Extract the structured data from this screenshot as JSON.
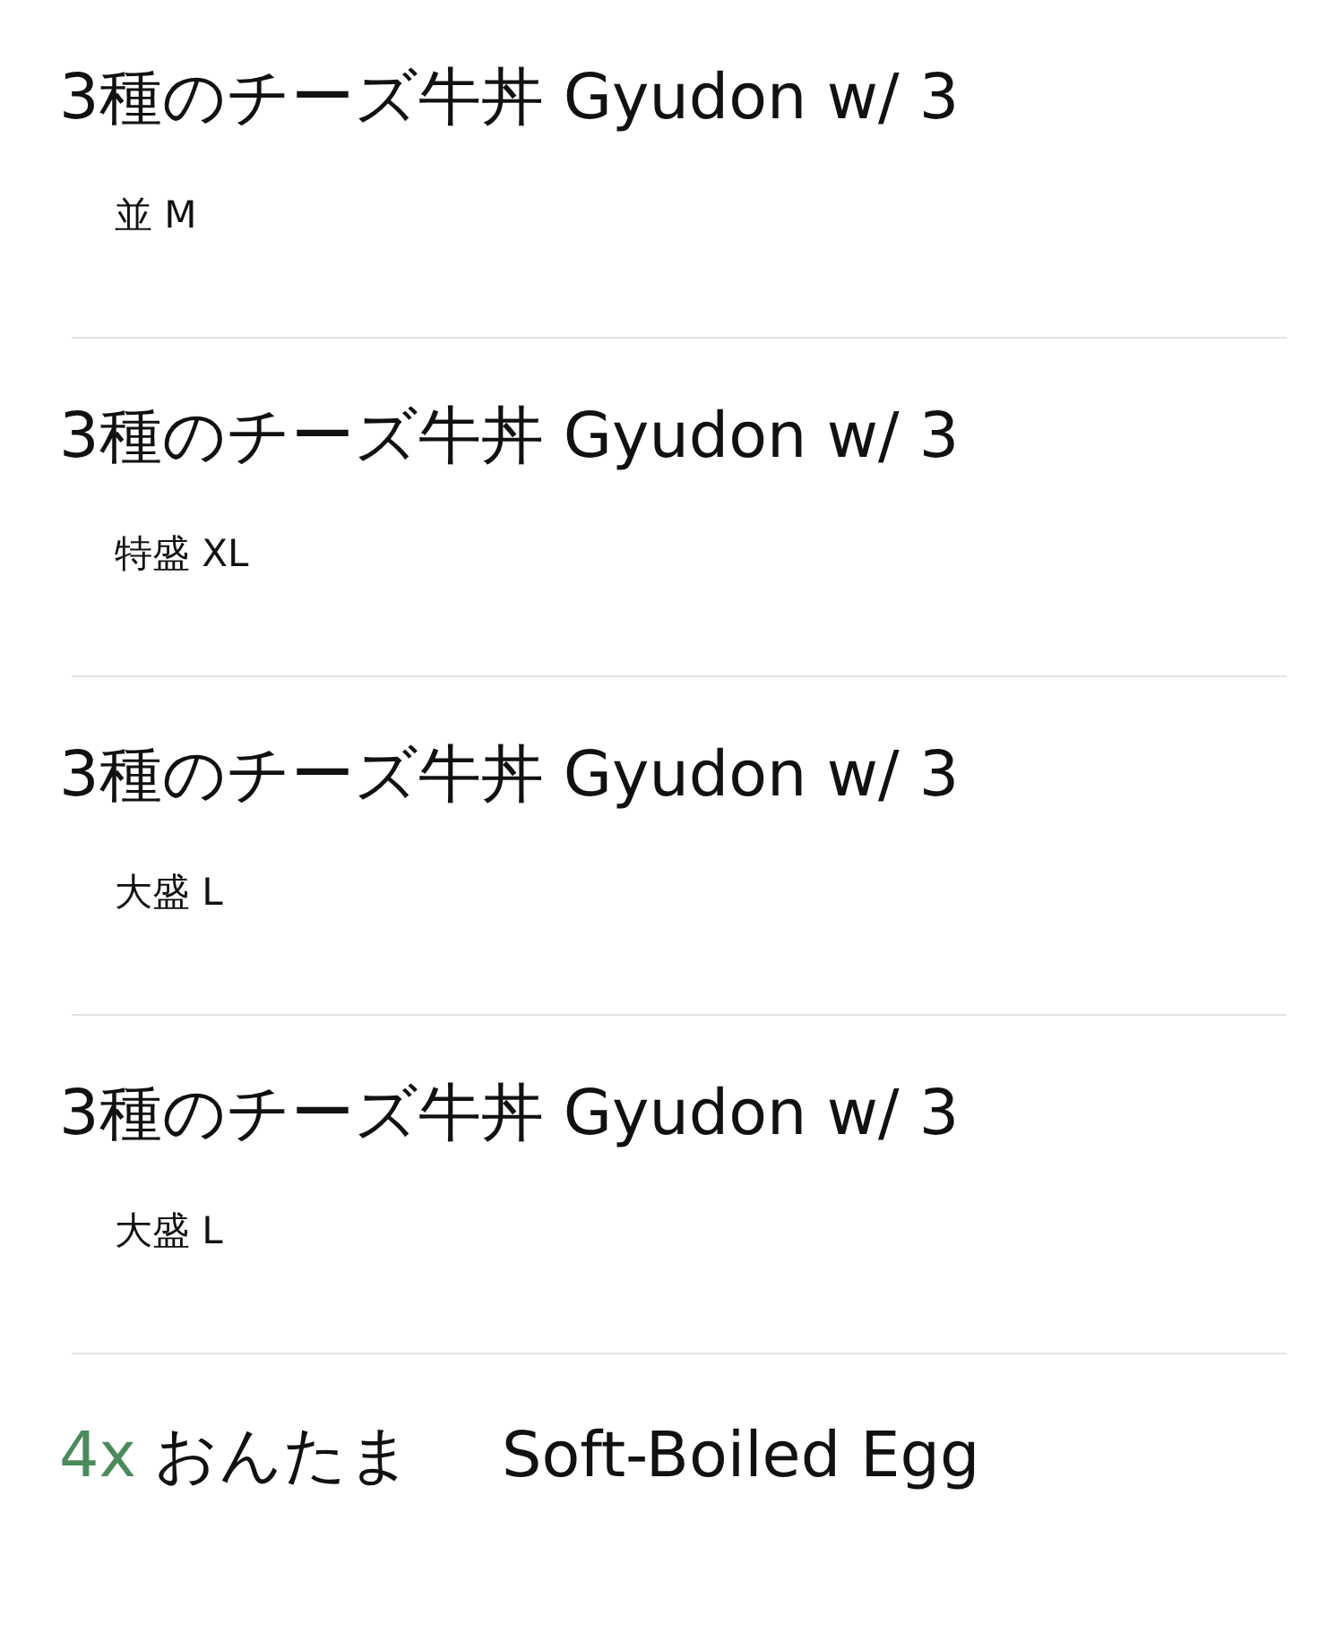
{
  "items": [
    {
      "title": "3種のチーズ牛丼 Gyudon w/ 3",
      "size": "並 M"
    },
    {
      "title": "3種のチーズ牛丼 Gyudon w/ 3",
      "size": "特盛 XL"
    },
    {
      "title": "3種のチーズ牛丼 Gyudon w/ 3",
      "size": "大盛 L"
    },
    {
      "title": "3種のチーズ牛丼 Gyudon w/ 3",
      "size": "大盛 L"
    }
  ],
  "extra": {
    "quantity": "4x",
    "name": "おんたま",
    "english": "Soft-Boiled Egg"
  }
}
